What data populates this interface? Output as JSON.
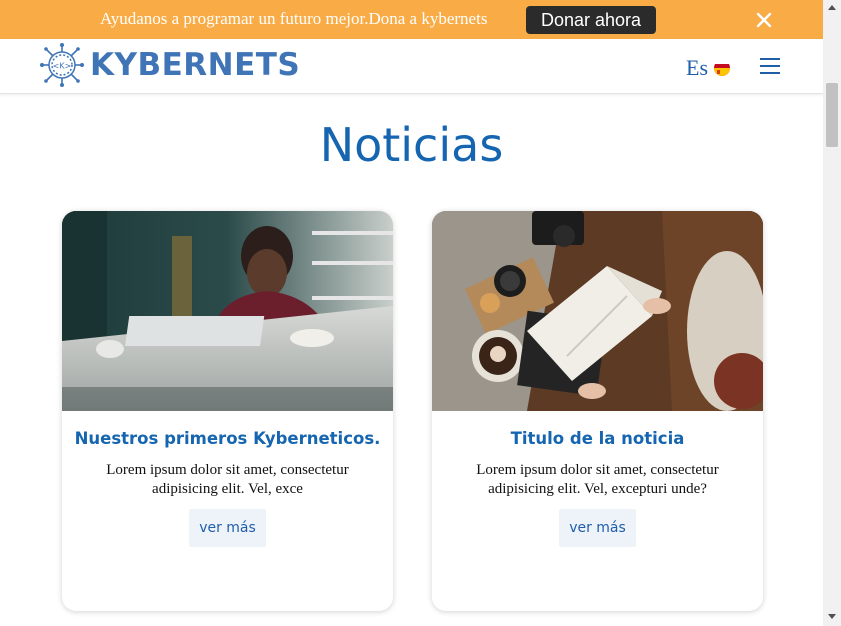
{
  "banner": {
    "text": "Ayudanos a programar un futuro mejor.Dona a kybernets",
    "donate_label": "Donar ahora",
    "close_icon": "close-icon"
  },
  "header": {
    "logo_text": "KYBERNETS",
    "logo_mark": "<K>",
    "language_label": "Es",
    "flag_icon": "spain-flag-icon",
    "menu_icon": "hamburger-menu-icon"
  },
  "main": {
    "title": "Noticias",
    "cards": [
      {
        "title": "Nuestros primeros Kyberneticos.",
        "text": "Lorem ipsum dolor sit amet, consectetur adipisicing elit. Vel, exce",
        "button_label": "ver más",
        "image": "photo-person-with-laptop"
      },
      {
        "title": "Titulo de la noticia",
        "text": "Lorem ipsum dolor sit amet, consectetur adipisicing elit. Vel, excepturi unde?",
        "button_label": "ver más",
        "image": "photo-book-coffee-table"
      }
    ]
  },
  "colors": {
    "banner": "#f9ac46",
    "brand_blue": "#1565b0",
    "logo_blue": "#3f74b6",
    "button_bg": "#eef3fa"
  }
}
